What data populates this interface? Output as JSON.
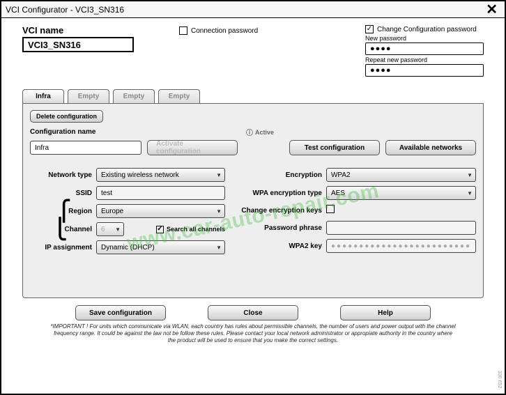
{
  "window": {
    "title": "VCI Configurator - VCI3_SN316",
    "close": "✕"
  },
  "header": {
    "vci_name_label": "VCI name",
    "vci_name_value": "VCI3_SN316",
    "connection_password_label": "Connection password",
    "change_config_password_label": "Change Configuration password",
    "new_password_label": "New password",
    "new_password_value": "●●●●",
    "repeat_password_label": "Repeat new password",
    "repeat_password_value": "●●●●"
  },
  "tabs": {
    "t0": "Infra",
    "t1": "Empty",
    "t2": "Empty",
    "t3": "Empty"
  },
  "panel": {
    "delete_btn": "Delete configuration",
    "config_name_label": "Configuration name",
    "active_badge": "Active",
    "config_name_value": "Infra",
    "activate_btn": "Activate configuration",
    "test_btn": "Test configuration",
    "networks_btn": "Available networks",
    "left": {
      "network_type_label": "Network type",
      "network_type_value": "Existing wireless network",
      "ssid_label": "SSID",
      "ssid_value": "test",
      "region_label": "Region",
      "region_value": "Europe",
      "channel_label": "Channel",
      "channel_value": "6",
      "search_all_label": "Search all channels",
      "ip_label": "IP assignment",
      "ip_value": "Dynamic (DHCP)"
    },
    "right": {
      "encryption_label": "Encryption",
      "encryption_value": "WPA2",
      "wpa_type_label": "WPA encryption type",
      "wpa_type_value": "AES",
      "change_keys_label": "Change encryption keys",
      "passphrase_label": "Password phrase",
      "passphrase_value": "",
      "wpa2_key_label": "WPA2 key",
      "wpa2_key_value": "●●●●●●●●●●●●●●●●●●●●●●●●●"
    }
  },
  "footer": {
    "save_btn": "Save configuration",
    "close_btn": "Close",
    "help_btn": "Help",
    "note": "*IMPORTANT ! For units which communicate via WLAN, each country has rules about permissible channels, the number of users and power output with the channel frequency range. It could be against the law not be follow these rules. Please contact your local network administrator or appropiate authority in the country where the product will be used to ensure that you make the correct settings."
  },
  "sideref": "336 652",
  "watermark": "www.car-auto-repair.com"
}
